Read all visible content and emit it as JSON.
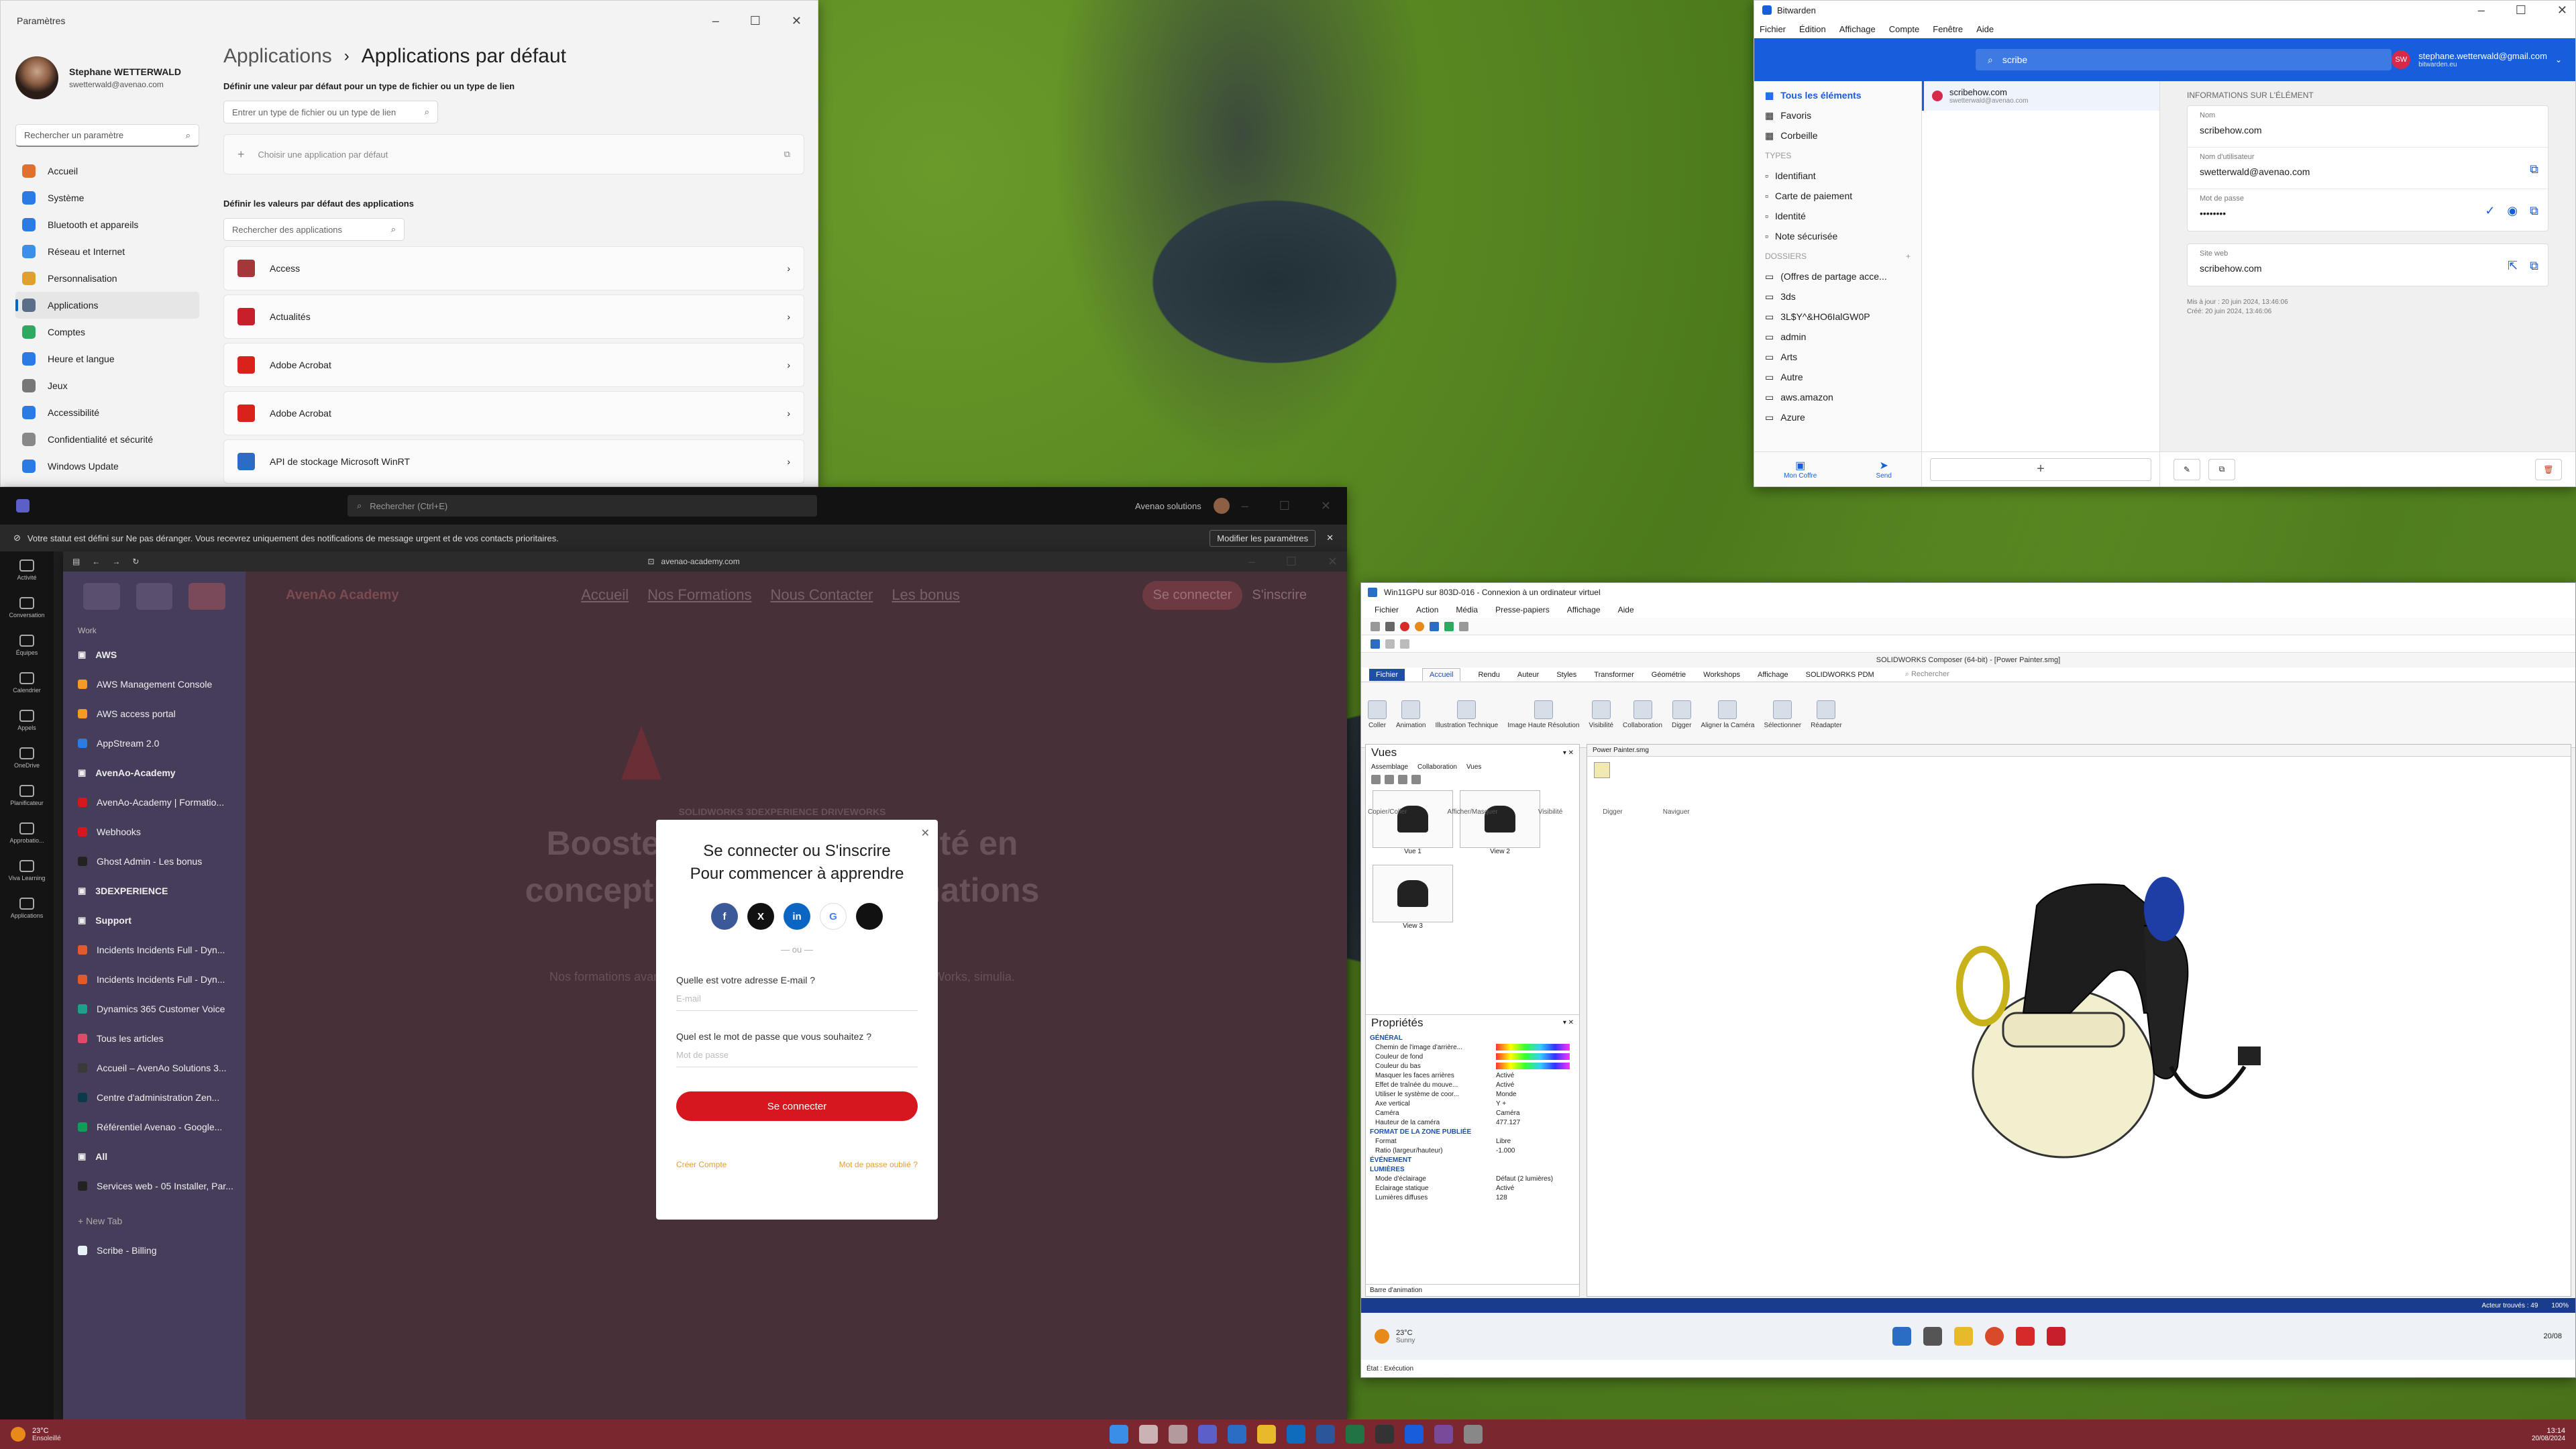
{
  "settings": {
    "window_title": "Paramètres",
    "user_name": "Stephane WETTERWALD",
    "user_email": "swetterwald@avenao.com",
    "search_placeholder": "Rechercher un paramètre",
    "nav": [
      {
        "label": "Accueil",
        "color": "#e07030"
      },
      {
        "label": "Système",
        "color": "#2c7be5"
      },
      {
        "label": "Bluetooth et appareils",
        "color": "#2c7be5"
      },
      {
        "label": "Réseau et Internet",
        "color": "#3b8fe6"
      },
      {
        "label": "Personnalisation",
        "color": "#e0a030"
      },
      {
        "label": "Applications",
        "color": "#5a6e8a"
      },
      {
        "label": "Comptes",
        "color": "#2fa860"
      },
      {
        "label": "Heure et langue",
        "color": "#2c7be5"
      },
      {
        "label": "Jeux",
        "color": "#777777"
      },
      {
        "label": "Accessibilité",
        "color": "#2c7be5"
      },
      {
        "label": "Confidentialité et sécurité",
        "color": "#888888"
      },
      {
        "label": "Windows Update",
        "color": "#2c7be5"
      }
    ],
    "breadcrumb_parent": "Applications",
    "breadcrumb_sep": "›",
    "page_title": "Applications par défaut",
    "file_type_heading": "Définir une valeur par défaut pour un type de fichier ou un type de lien",
    "file_type_placeholder": "Entrer un type de fichier ou un type de lien",
    "choose_default": "Choisir une application par défaut",
    "apps_heading": "Définir les valeurs par défaut des applications",
    "apps_search_placeholder": "Rechercher des applications",
    "apps": [
      {
        "label": "Access",
        "color": "#a4373a"
      },
      {
        "label": "Actualités",
        "color": "#c8202a"
      },
      {
        "label": "Adobe Acrobat",
        "color": "#d8221a"
      },
      {
        "label": "Adobe Acrobat",
        "color": "#d8221a"
      },
      {
        "label": "API de stockage Microsoft WinRT",
        "color": "#2b6cc4"
      }
    ]
  },
  "bitwarden": {
    "window_title": "Bitwarden",
    "menu": [
      "Fichier",
      "Édition",
      "Affichage",
      "Compte",
      "Fenêtre",
      "Aide"
    ],
    "search_value": "scribe",
    "account_email": "stephane.wetterwald@gmail.com",
    "account_server": "bitwarden.eu",
    "account_initials": "SW",
    "left_items": [
      "Tous les éléments",
      "Favoris",
      "Corbeille"
    ],
    "types_heading": "TYPES",
    "types": [
      "Identifiant",
      "Carte de paiement",
      "Identité",
      "Note sécurisée"
    ],
    "folders_heading": "DOSSIERS",
    "folders": [
      "(Offres de partage acce...",
      "3ds",
      "3L$Y^&HO6IalGW0P",
      "admin",
      "Arts",
      "Autre",
      "aws.amazon",
      "Azure"
    ],
    "bottom_tabs": [
      "Mon Coffre",
      "Send"
    ],
    "list_item_title": "scribehow.com",
    "list_item_sub": "swetterwald@avenao.com",
    "info_heading": "INFORMATIONS SUR L'ÉLÉMENT",
    "fields": [
      {
        "label": "Nom",
        "value": "scribehow.com"
      },
      {
        "label": "Nom d'utilisateur",
        "value": "swetterwald@avenao.com"
      },
      {
        "label": "Mot de passe",
        "value": "••••••••"
      }
    ],
    "site_label": "Site web",
    "site_value": "scribehow.com",
    "updated": "Mis à jour : 20 juin 2024, 13:46:06",
    "created": "Créé: 20 juin 2024, 13:46:06"
  },
  "teams": {
    "search_placeholder": "Rechercher (Ctrl+E)",
    "org": "Avenao solutions",
    "notice": "Votre statut est défini sur Ne pas déranger. Vous recevrez uniquement des notifications de message urgent et de vos contacts prioritaires.",
    "notice_button": "Modifier les paramètres",
    "rail": [
      "Activité",
      "Conversation",
      "Équipes",
      "Calendrier",
      "Appels",
      "OneDrive",
      "Planificateur",
      "Approbatio...",
      "Viva Learning",
      "Applications"
    ]
  },
  "browser": {
    "url": "avenao-academy.com",
    "workspace": "Work",
    "items": [
      {
        "label": "AWS",
        "folder": true,
        "color": "#888888"
      },
      {
        "label": "AWS Management Console",
        "folder": false,
        "color": "#f59a23"
      },
      {
        "label": "AWS access portal",
        "folder": false,
        "color": "#f59a23"
      },
      {
        "label": "AppStream 2.0",
        "folder": false,
        "color": "#2b7be0"
      },
      {
        "label": "AvenAo-Academy",
        "folder": true,
        "color": "#888888"
      },
      {
        "label": "AvenAo-Academy | Formatio...",
        "folder": false,
        "color": "#d6171f"
      },
      {
        "label": "Webhooks",
        "folder": false,
        "color": "#d6171f"
      },
      {
        "label": "Ghost Admin - Les bonus",
        "folder": false,
        "color": "#222222"
      },
      {
        "label": "3DEXPERIENCE",
        "folder": true,
        "color": "#888888"
      },
      {
        "label": "Support",
        "folder": true,
        "color": "#888888"
      },
      {
        "label": "Incidents Incidents Full - Dyn...",
        "folder": false,
        "color": "#e35a2a"
      },
      {
        "label": "Incidents Incidents Full - Dyn...",
        "folder": false,
        "color": "#e35a2a"
      },
      {
        "label": "Dynamics 365 Customer Voice",
        "folder": false,
        "color": "#1f9e8a"
      },
      {
        "label": "Tous les articles",
        "folder": false,
        "color": "#e04a6a"
      },
      {
        "label": "Accueil – AvenAo Solutions 3...",
        "folder": false,
        "color": "#3a3a3a"
      },
      {
        "label": "Centre d'administration Zen...",
        "folder": false,
        "color": "#0b3a4a"
      },
      {
        "label": "Référentiel Avenao - Google...",
        "folder": false,
        "color": "#0f9d58"
      },
      {
        "label": "All",
        "folder": true,
        "color": "#888888"
      },
      {
        "label": "Services web - 05 Installer, Par...",
        "folder": false,
        "color": "#222222"
      }
    ],
    "new_tab": "+ New Tab",
    "pinned": "Scribe - Billing",
    "nav_links": [
      "Accueil",
      "Nos Formations",
      "Nous Contacter",
      "Les bonus"
    ],
    "logo": "AvenAo Academy",
    "login_btn": "Se connecter",
    "signup_btn": "S'inscrire",
    "tagline_small": "SOLIDWORKS 3DEXPERIENCE DRIVEWORKS",
    "hero_line1": "Boostez votre productivité en",
    "hero_line2": "conception avec nos formations",
    "hero_sub": "Nos formations avancées pour SOLIDWORKS, 3DEXPERIENCE, DriveWorks, simulia.",
    "modal": {
      "title1": "Se connecter ou S'inscrire",
      "title2": "Pour commencer à apprendre",
      "social": [
        {
          "label": "f",
          "color": "#3b5998"
        },
        {
          "label": "X",
          "color": "#111111"
        },
        {
          "label": "in",
          "color": "#0a66c2"
        },
        {
          "label": "G",
          "color": "#ffffff"
        },
        {
          "label": "",
          "color": "#111111"
        }
      ],
      "or": "— ou —",
      "email_label": "Quelle est votre adresse E-mail ?",
      "email_placeholder": "E-mail",
      "password_label": "Quel est le mot de passe que vous souhaitez ?",
      "password_placeholder": "Mot de passe",
      "submit": "Se connecter",
      "create": "Créer Compte",
      "forgot": "Mot de passe oublié ?"
    }
  },
  "solidworks": {
    "window_title": "Win11GPU sur 803D-016 - Connexion à un ordinateur virtuel",
    "rdp_menu": [
      "Fichier",
      "Action",
      "Média",
      "Presse-papiers",
      "Affichage",
      "Aide"
    ],
    "app_caption": "SOLIDWORKS Composer (64-bit) - [Power Painter.smg]",
    "ribbon_tabs": [
      "Fichier",
      "Accueil",
      "Rendu",
      "Auteur",
      "Styles",
      "Transformer",
      "Géométrie",
      "Workshops",
      "Affichage",
      "SOLIDWORKS PDM"
    ],
    "ribbon_search": "Rechercher",
    "ribbon_buttons": [
      "Coller",
      "Animation",
      "Illustration Technique",
      "Image Haute Résolution",
      "Visibilité",
      "Collaboration",
      "Digger",
      "Aligner la Caméra",
      "Sélectionner",
      "Réadapter"
    ],
    "ribbon_groups": [
      "Copier/Coller",
      "Afficher/Masquer",
      "Visibilité",
      "Digger",
      "Naviguer"
    ],
    "views_title": "Vues",
    "views_tabs": [
      "Assemblage",
      "Collaboration",
      "Vues"
    ],
    "views": [
      "Vue 1",
      "View 2",
      "View 3"
    ],
    "props_title": "Propriétés",
    "props_sections": [
      "GÉNÉRAL",
      "FORMAT DE LA ZONE PUBLIÉE",
      "ÉVÉNEMENT",
      "LUMIÈRES"
    ],
    "props": [
      {
        "k": "Chemin de l'image d'arrière...",
        "v": ""
      },
      {
        "k": "Couleur de fond",
        "v": ""
      },
      {
        "k": "Couleur du bas",
        "v": ""
      },
      {
        "k": "Masquer les faces arrières",
        "v": "Activé"
      },
      {
        "k": "Effet de traînée du mouve...",
        "v": "Activé"
      },
      {
        "k": "Utiliser le système de coor...",
        "v": "Monde"
      },
      {
        "k": "Axe vertical",
        "v": "Y +"
      },
      {
        "k": "Caméra",
        "v": "Caméra"
      },
      {
        "k": "Hauteur de la caméra",
        "v": "477.127"
      },
      {
        "k": "Format",
        "v": "Libre"
      },
      {
        "k": "Ratio (largeur/hauteur)",
        "v": "-1.000"
      },
      {
        "k": "Mode d'éclairage",
        "v": "Défaut (2 lumières)"
      },
      {
        "k": "Éclairage statique",
        "v": "Activé"
      },
      {
        "k": "Lumières diffuses",
        "v": "128"
      }
    ],
    "anim_bar": "Barre d'animation",
    "doc_tab": "Power Painter.smg",
    "status": "Acteur trouvés : 49",
    "zoom": "100%",
    "weather_temp": "23°C",
    "weather_cond": "Sunny",
    "state": "État : Exécution",
    "rdp_date": "20/08"
  },
  "taskbar": {
    "weather_temp": "23°C",
    "weather_cond": "Ensoleillé",
    "time": "13:14",
    "date": "20/08/2024"
  }
}
